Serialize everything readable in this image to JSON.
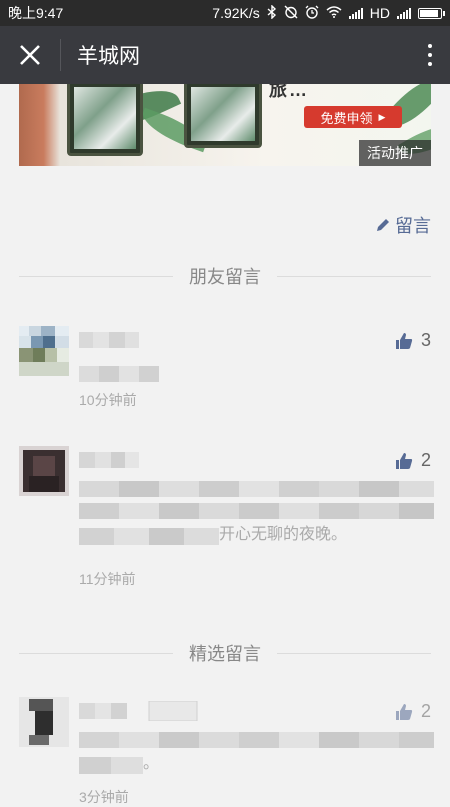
{
  "status_bar": {
    "time": "晚上9:47",
    "net_speed": "7.92K/s",
    "network_type": "HD",
    "battery_level": 0.9,
    "icons": [
      "bluetooth-icon",
      "alarm-off-icon",
      "alarm-clock-icon",
      "wifi-icon",
      "signal-icon",
      "battery-icon"
    ]
  },
  "nav": {
    "title": "羊城网",
    "close_icon": "close-icon",
    "more_icon": "more-vert-icon"
  },
  "banner": {
    "headline": "旅…",
    "apply_label": "免费申领",
    "promo_tag": "活动推广"
  },
  "comments_action": {
    "write_label": "留言",
    "icon": "pencil-icon"
  },
  "friends_section": {
    "title": "朋友留言",
    "comments": [
      {
        "likes": "3",
        "time": "10分钟前",
        "text": "",
        "blurred": true
      },
      {
        "likes": "2",
        "time": "11分钟前",
        "text": "开心无聊的夜晚。",
        "blurred": true
      }
    ]
  },
  "featured_section": {
    "title": "精选留言",
    "comments": [
      {
        "likes": "2",
        "time": "3分钟前",
        "text": "。",
        "blurred": true
      }
    ]
  },
  "colors": {
    "status_bar": "#2b2b2b",
    "nav_bar": "#393a3f",
    "page_bg": "#f2f2f2",
    "link_blue": "#576b95",
    "apply_red": "#d63a2e"
  }
}
